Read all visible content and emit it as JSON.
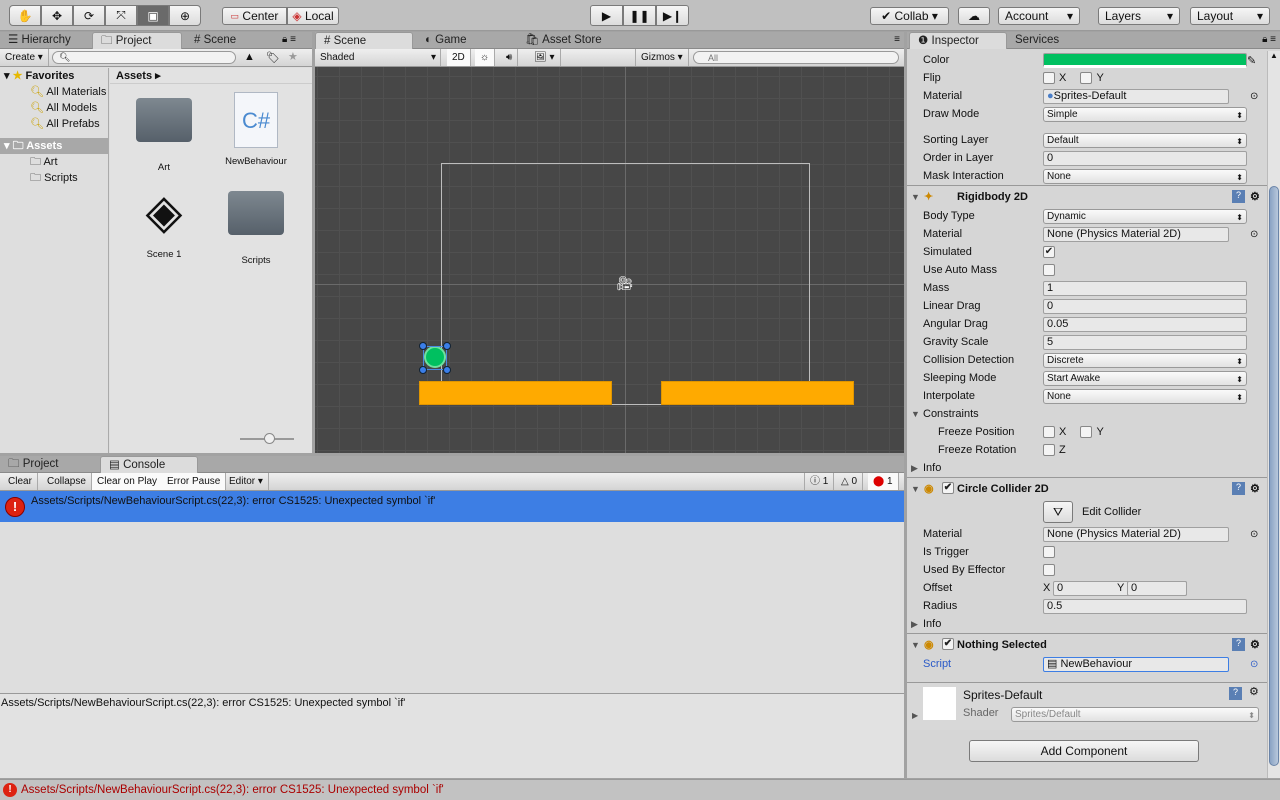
{
  "toolbar": {
    "tools": [
      "hand-tool",
      "move-tool",
      "rotate-tool",
      "scale-tool",
      "rect-tool",
      "transform-tool"
    ],
    "center": "Center",
    "local": "Local",
    "collab": "Collab",
    "account": "Account",
    "layers": "Layers",
    "layout": "Layout"
  },
  "left_panel": {
    "tabs": [
      "Hierarchy",
      "Project",
      "Scene"
    ],
    "create": "Create",
    "favorites": "Favorites",
    "fav_items": [
      "All Materials",
      "All Models",
      "All Prefabs"
    ],
    "assets": "Assets",
    "asset_folders": [
      "Art",
      "Scripts"
    ],
    "breadcrumb": "Assets",
    "grid": [
      {
        "name": "Art",
        "icon": "folder-icon"
      },
      {
        "name": "NewBehaviour",
        "icon": "csharp-script-icon"
      },
      {
        "name": "Scene 1",
        "icon": "unity-scene-icon"
      },
      {
        "name": "Scripts",
        "icon": "folder-icon"
      }
    ]
  },
  "scene": {
    "tabs": [
      "Scene",
      "Game",
      "Asset Store"
    ],
    "shading": "Shaded",
    "mode2d": "2D",
    "gizmos": "Gizmos",
    "search_placeholder": "All"
  },
  "console": {
    "tabs": [
      "Project",
      "Console"
    ],
    "buttons": [
      "Clear",
      "Collapse",
      "Clear on Play",
      "Error Pause",
      "Editor"
    ],
    "counts": {
      "info": "1",
      "warn": "0",
      "error": "1"
    },
    "message": "Assets/Scripts/NewBehaviourScript.cs(22,3): error CS1525: Unexpected symbol `if'",
    "detail": "Assets/Scripts/NewBehaviourScript.cs(22,3): error CS1525: Unexpected symbol `if'"
  },
  "status_bar": {
    "message": "Assets/Scripts/NewBehaviourScript.cs(22,3): error CS1525: Unexpected symbol `if'"
  },
  "inspector": {
    "tabs": [
      "Inspector",
      "Services"
    ],
    "sprite_color": "#00c060",
    "rows": [
      {
        "t": "color",
        "label": "Color"
      },
      {
        "t": "xy",
        "label": "Flip",
        "a": "X",
        "b": "Y"
      },
      {
        "t": "obj",
        "label": "Material",
        "value": "Sprites-Default"
      },
      {
        "t": "pop",
        "label": "Draw Mode",
        "value": "Simple"
      },
      {
        "t": "gap"
      },
      {
        "t": "pop",
        "label": "Sorting Layer",
        "value": "Default"
      },
      {
        "t": "field",
        "label": "Order in Layer",
        "value": "0"
      },
      {
        "t": "pop",
        "label": "Mask Interaction",
        "value": "None"
      },
      {
        "t": "hdr",
        "label": "Rigidbody 2D",
        "icon": "rigidbody-icon"
      },
      {
        "t": "pop",
        "label": "Body Type",
        "value": "Dynamic"
      },
      {
        "t": "obj",
        "label": "Material",
        "value": "None (Physics Material 2D)"
      },
      {
        "t": "chk",
        "label": "Simulated",
        "checked": true
      },
      {
        "t": "chk",
        "label": "Use Auto Mass",
        "checked": false
      },
      {
        "t": "field",
        "label": "Mass",
        "value": "1"
      },
      {
        "t": "field",
        "label": "Linear Drag",
        "value": "0"
      },
      {
        "t": "field",
        "label": "Angular Drag",
        "value": "0.05"
      },
      {
        "t": "field",
        "label": "Gravity Scale",
        "value": "5"
      },
      {
        "t": "pop",
        "label": "Collision Detection",
        "value": "Discrete"
      },
      {
        "t": "pop",
        "label": "Sleeping Mode",
        "value": "Start Awake"
      },
      {
        "t": "pop",
        "label": "Interpolate",
        "value": "None"
      },
      {
        "t": "fold",
        "label": "Constraints",
        "open": true
      },
      {
        "t": "xy",
        "label": "Freeze Position",
        "a": "X",
        "b": "Y",
        "indent": true
      },
      {
        "t": "xy",
        "label": "Freeze Rotation",
        "a": "Z",
        "indent": true
      },
      {
        "t": "fold",
        "label": "Info",
        "open": false
      },
      {
        "t": "hdr",
        "label": "Circle Collider 2D",
        "icon": "circle-collider-icon",
        "checked": true
      },
      {
        "t": "editbtn",
        "label": "Edit Collider"
      },
      {
        "t": "obj",
        "label": "Material",
        "value": "None (Physics Material 2D)"
      },
      {
        "t": "chk",
        "label": "Is Trigger",
        "checked": false
      },
      {
        "t": "chk",
        "label": "Used By Effector",
        "checked": false
      },
      {
        "t": "vec2",
        "label": "Offset",
        "x": "0",
        "y": "0"
      },
      {
        "t": "field",
        "label": "Radius",
        "value": "0.5"
      },
      {
        "t": "fold",
        "label": "Info",
        "open": false
      },
      {
        "t": "hdr",
        "label": "Nothing Selected",
        "icon": "script-icon",
        "checked": true
      },
      {
        "t": "script",
        "label": "Script",
        "value": "NewBehaviour"
      }
    ],
    "material": {
      "name": "Sprites-Default",
      "shader_label": "Shader",
      "shader": "Sprites/Default"
    },
    "add_component": "Add Component"
  }
}
